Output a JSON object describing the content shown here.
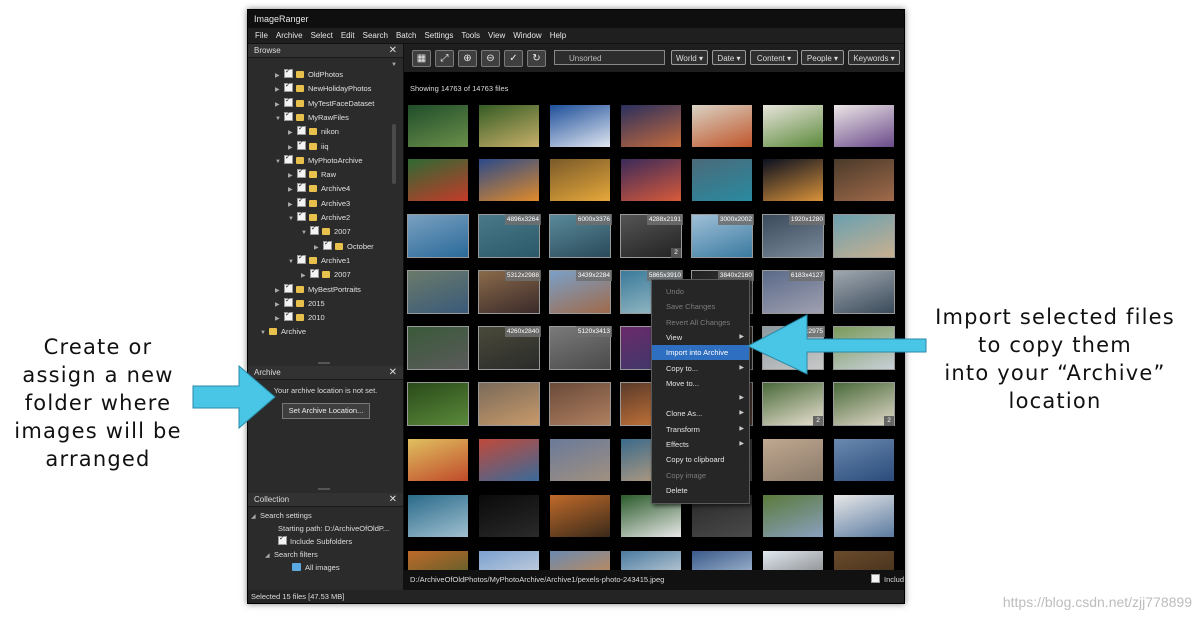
{
  "annotations": {
    "left_lines": [
      "Create or",
      "assign a new",
      "folder where",
      "images will be",
      "arranged"
    ],
    "right_lines": [
      "Import selected files",
      "to copy them",
      "into your “Archive”",
      "location"
    ]
  },
  "watermark": "https://blog.csdn.net/zjj778899",
  "app": {
    "title": "ImageRanger",
    "menu": [
      "File",
      "Archive",
      "Select",
      "Edit",
      "Search",
      "Batch",
      "Settings",
      "Tools",
      "View",
      "Window",
      "Help"
    ]
  },
  "browse": {
    "title": "Browse",
    "tree": [
      {
        "label": "OldPhotos",
        "level": 1
      },
      {
        "label": "NewHolidayPhotos",
        "level": 1
      },
      {
        "label": "MyTestFaceDataset",
        "level": 1
      },
      {
        "label": "MyRawFiles",
        "level": 1
      },
      {
        "label": "nikon",
        "level": 2
      },
      {
        "label": "iiq",
        "level": 2
      },
      {
        "label": "MyPhotoArchive",
        "level": 1
      },
      {
        "label": "Raw",
        "level": 2
      },
      {
        "label": "Archive4",
        "level": 2
      },
      {
        "label": "Archive3",
        "level": 2
      },
      {
        "label": "Archive2",
        "level": 2
      },
      {
        "label": "2007",
        "level": 3
      },
      {
        "label": "October",
        "level": 4
      },
      {
        "label": "Archive1",
        "level": 2
      },
      {
        "label": "2007",
        "level": 3
      },
      {
        "label": "MyBestPortraits",
        "level": 1
      },
      {
        "label": "2015",
        "level": 1
      },
      {
        "label": "2010",
        "level": 1
      },
      {
        "label": "Archive",
        "level": 0
      }
    ]
  },
  "archive": {
    "title": "Archive",
    "message": "Your archive location is not set.",
    "button": "Set Archive Location..."
  },
  "collection": {
    "title": "Collection",
    "search_settings": "Search settings",
    "starting_path": "Starting path: D:/ArchiveOfOldP...",
    "include_subfolders": "Include Subfolders",
    "search_filters": "Search filters",
    "all_images": "All images"
  },
  "toolbar": {
    "sort": "Unsorted",
    "filters": [
      "World",
      "Date",
      "Content",
      "People",
      "Keywords"
    ]
  },
  "showing": "Showing 14763 of 14763 files",
  "thumbnails": [
    {
      "colors": [
        "#1f4d2a",
        "#6b8f4a"
      ]
    },
    {
      "colors": [
        "#355c24",
        "#c8b06a"
      ]
    },
    {
      "colors": [
        "#1e4f9a",
        "#e0e6f0"
      ]
    },
    {
      "colors": [
        "#2a2f5e",
        "#c46a3c"
      ]
    },
    {
      "colors": [
        "#d9d2c4",
        "#c0552a"
      ]
    },
    {
      "colors": [
        "#e8e4dc",
        "#5b8a3a"
      ]
    },
    {
      "colors": [
        "#ece6e6",
        "#6a4a8a"
      ]
    },
    {
      "colors": [
        "#2e6a33",
        "#c43a2a"
      ]
    },
    {
      "colors": [
        "#2b4a8a",
        "#e08a2a"
      ]
    },
    {
      "colors": [
        "#7a5a2a",
        "#e6a83a"
      ]
    },
    {
      "colors": [
        "#3a2a5a",
        "#d85a3a"
      ]
    },
    {
      "colors": [
        "#4a6a7a",
        "#2a8aa0"
      ]
    },
    {
      "colors": [
        "#0a1020",
        "#d9923a"
      ]
    },
    {
      "colors": [
        "#4a3a2a",
        "#a06a4a"
      ]
    },
    {
      "colors": [
        "#7aa0c0",
        "#2a6a9a"
      ],
      "res": ""
    },
    {
      "colors": [
        "#4a7a8a",
        "#2a5a6a"
      ],
      "res": "4896x3264"
    },
    {
      "colors": [
        "#5a8a9a",
        "#2a4a5a"
      ],
      "res": "6000x3376"
    },
    {
      "colors": [
        "#555555",
        "#222222"
      ],
      "res": "4288x2191",
      "count": "2"
    },
    {
      "colors": [
        "#a0c0d8",
        "#3a7aa0"
      ],
      "res": "3000x2002"
    },
    {
      "colors": [
        "#3a4a5a",
        "#7a8a9a"
      ],
      "res": "1920x1280"
    },
    {
      "colors": [
        "#6aa0b0",
        "#c8b090"
      ],
      "res": ""
    },
    {
      "colors": [
        "#6a7a6a",
        "#3a5a7a"
      ],
      "res": ""
    },
    {
      "colors": [
        "#8a6a4a",
        "#3a2a2a"
      ],
      "res": "5312x2988"
    },
    {
      "colors": [
        "#7aa0c8",
        "#a06a4a"
      ],
      "res": "3439x2284"
    },
    {
      "colors": [
        "#3a7a9a",
        "#a0c0c8"
      ],
      "res": "5865x3910"
    },
    {
      "colors": [
        "#202020",
        "#505050"
      ],
      "res": "3840x2160"
    },
    {
      "colors": [
        "#5a6a8a",
        "#a0a0b0"
      ],
      "res": "6183x4127"
    },
    {
      "colors": [
        "#a0a8b0",
        "#3a4a5a"
      ],
      "res": ""
    },
    {
      "colors": [
        "#3a5a3a",
        "#5a5a5a"
      ],
      "res": ""
    },
    {
      "colors": [
        "#4a4a3a",
        "#2a2a2a"
      ],
      "res": "4260x2840"
    },
    {
      "colors": [
        "#7a7a7a",
        "#4a4a4a"
      ],
      "res": "5120x3413"
    },
    {
      "colors": [
        "#6a2a6a",
        "#3a3a6a"
      ],
      "res": ""
    },
    {
      "colors": [
        "#4a3a2a",
        "#2a2a2a"
      ],
      "res": ""
    },
    {
      "colors": [
        "#8a9aa0",
        "#c8c8c8"
      ],
      "res": "4x2975"
    },
    {
      "colors": [
        "#7a9a5a",
        "#c8d0d8"
      ],
      "res": ""
    },
    {
      "colors": [
        "#2a4a1a",
        "#5a8a3a"
      ],
      "res": ""
    },
    {
      "colors": [
        "#7a6a5a",
        "#c89a6a"
      ],
      "res": ""
    },
    {
      "colors": [
        "#6a4a3a",
        "#b08060"
      ],
      "res": ""
    },
    {
      "colors": [
        "#5a3a2a",
        "#d07a3a"
      ],
      "res": ""
    },
    {
      "colors": [
        "#3a2a2a",
        "#6a4a3a"
      ],
      "res": ""
    },
    {
      "colors": [
        "#4a6a3a",
        "#e8e0d0"
      ],
      "res": "",
      "count": "2"
    },
    {
      "colors": [
        "#4a6a3a",
        "#e0d8c8"
      ],
      "res": "",
      "count": "2"
    },
    {
      "colors": [
        "#e0c060",
        "#c04a2a"
      ],
      "res": ""
    },
    {
      "colors": [
        "#c04a3a",
        "#3a6a9a"
      ],
      "res": ""
    },
    {
      "colors": [
        "#6a7a9a",
        "#a09080"
      ],
      "res": ""
    },
    {
      "colors": [
        "#3a6a8a",
        "#c0a080"
      ],
      "res": ""
    },
    {
      "colors": [
        "#3a3a3a",
        "#5a5a5a"
      ],
      "res": ""
    },
    {
      "colors": [
        "#c0a890",
        "#8a7a6a"
      ],
      "res": ""
    },
    {
      "colors": [
        "#6a8ab0",
        "#2a4a7a"
      ],
      "res": ""
    },
    {
      "colors": [
        "#2a6a8a",
        "#a0c0d0"
      ],
      "res": ""
    },
    {
      "colors": [
        "#0a0a0a",
        "#2a2a2a"
      ],
      "res": ""
    },
    {
      "colors": [
        "#c06a2a",
        "#3a2a1a"
      ],
      "res": ""
    },
    {
      "colors": [
        "#2a5a2a",
        "#e8e8e8"
      ],
      "res": ""
    },
    {
      "colors": [
        "#2a2a2a",
        "#4a4a4a"
      ],
      "res": ""
    },
    {
      "colors": [
        "#5a7a3a",
        "#8aa0c0"
      ],
      "res": ""
    },
    {
      "colors": [
        "#e8e8e8",
        "#5a7aa0"
      ],
      "res": ""
    },
    {
      "colors": [
        "#c06a2a",
        "#3a5a2a"
      ],
      "res": ""
    },
    {
      "colors": [
        "#7aa0d0",
        "#e0e0e0"
      ],
      "res": ""
    },
    {
      "colors": [
        "#6a8ab0",
        "#e08a3a"
      ],
      "res": ""
    },
    {
      "colors": [
        "#4a7aa0",
        "#e8e8e8"
      ],
      "res": ""
    },
    {
      "colors": [
        "#3a5a8a",
        "#c8d8e8"
      ],
      "res": ""
    },
    {
      "colors": [
        "#e0e8f0",
        "#6a6a6a"
      ],
      "res": ""
    },
    {
      "colors": [
        "#6a4a2a",
        "#3a2a1a"
      ],
      "res": ""
    }
  ],
  "context_menu": [
    {
      "label": "Undo",
      "disabled": true
    },
    {
      "label": "Save Changes",
      "disabled": true
    },
    {
      "label": "Revert All Changes",
      "disabled": true
    },
    {
      "label": "View",
      "submenu": true
    },
    {
      "label": "Import into Archive",
      "highlighted": true
    },
    {
      "label": "Copy to...",
      "submenu": true
    },
    {
      "label": "Move to..."
    },
    {
      "label": "",
      "submenu": true
    },
    {
      "label": "Clone As...",
      "submenu": true
    },
    {
      "label": "Transform",
      "submenu": true
    },
    {
      "label": "Effects",
      "submenu": true
    },
    {
      "label": "Copy to clipboard"
    },
    {
      "label": "Copy image",
      "disabled": true
    },
    {
      "label": "Delete"
    }
  ],
  "path": "D:/ArchiveOfOldPhotos/MyPhotoArchive/Archive1/pexels-photo-243415.jpeg",
  "include_label": "Include",
  "status": "Selected 15 files [47.53 MB]",
  "accent": "#49c6e5"
}
